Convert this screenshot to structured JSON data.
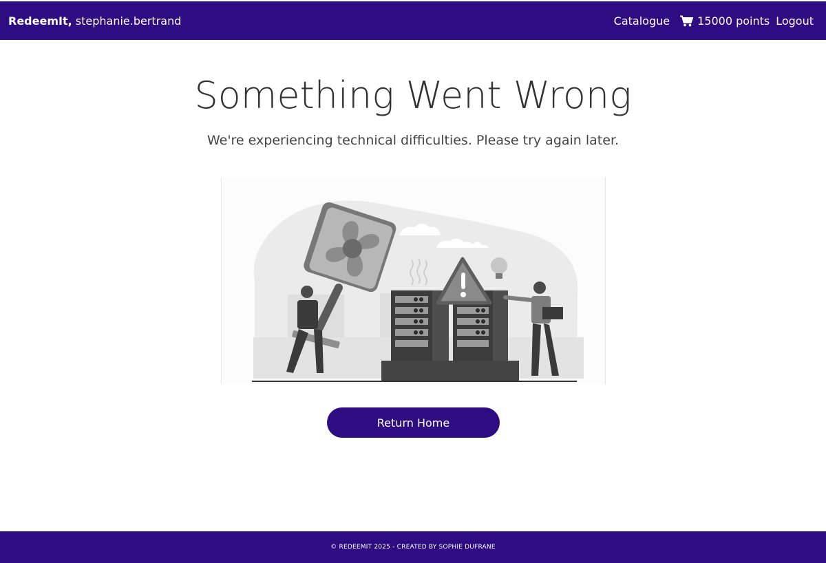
{
  "navbar": {
    "brand": "RedeemIt,",
    "username": "stephanie.bertrand",
    "catalogue_label": "Catalogue",
    "cart_icon": "shopping-cart-icon",
    "points_label": "15000 points",
    "logout_label": "Logout"
  },
  "main": {
    "title": "Something Went Wrong",
    "subtitle": "We're experiencing technical difficulties. Please try again later.",
    "illustration_icon": "server-repair-illustration",
    "button_label": "Return Home"
  },
  "footer": {
    "text": "© REDEEMIT 2025 - CREATED BY SOPHIE DUFRANE"
  },
  "colors": {
    "brand": "#2e0c82",
    "text": "#333333",
    "background": "#ffffff"
  }
}
